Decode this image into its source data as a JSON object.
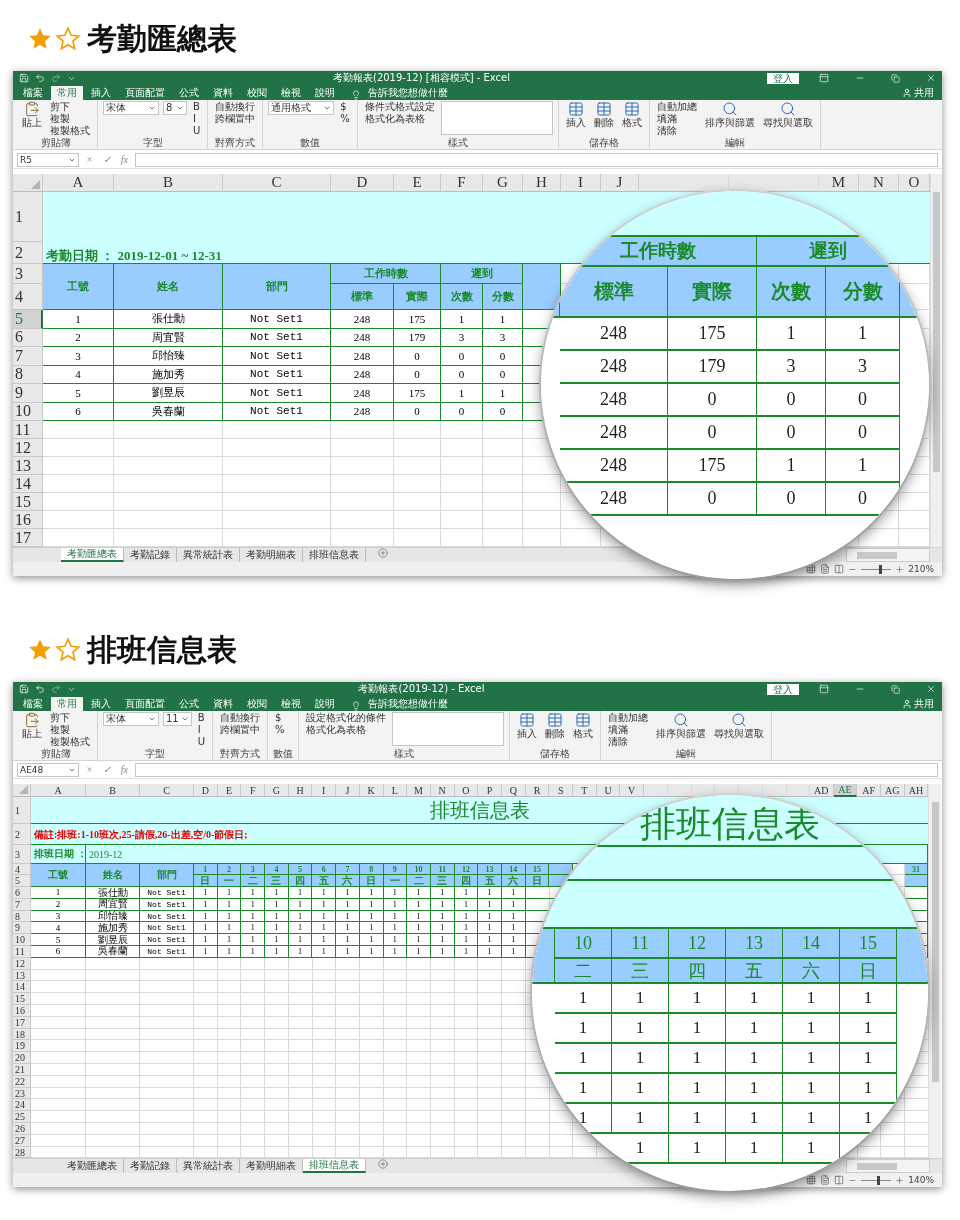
{
  "panels": [
    {
      "heading": "考勤匯總表",
      "window": {
        "title": "考勤報表(2019-12) [相容模式] - Excel",
        "sign_in": "登入",
        "tabs": [
          {
            "label": "檔案",
            "selected": false
          },
          {
            "label": "常用",
            "selected": true
          },
          {
            "label": "插入",
            "selected": false
          },
          {
            "label": "頁面配置",
            "selected": false
          },
          {
            "label": "公式",
            "selected": false
          },
          {
            "label": "資料",
            "selected": false
          },
          {
            "label": "校閱",
            "selected": false
          },
          {
            "label": "檢視",
            "selected": false
          },
          {
            "label": "說明",
            "selected": false
          }
        ],
        "tell_me": "告訴我您想做什麼",
        "share": "共用",
        "ribbon_groups": [
          {
            "label": "剪貼簿",
            "big": [
              "貼上"
            ],
            "items": [
              "剪下",
              "複製",
              "複製格式"
            ]
          },
          {
            "label": "字型",
            "fields": [
              "宋体",
              "8"
            ],
            "items": [
              "B",
              "I",
              "U"
            ]
          },
          {
            "label": "對齊方式",
            "items": [
              "自動換行",
              "跨欄置中"
            ]
          },
          {
            "label": "數值",
            "fields": [
              "通用格式"
            ],
            "items": [
              "$",
              "%"
            ]
          },
          {
            "label": "樣式",
            "items": [
              "條件式格式設定",
              "格式化為表格"
            ],
            "gallery": true
          },
          {
            "label": "儲存格",
            "big": [
              "插入",
              "刪除",
              "格式"
            ]
          },
          {
            "label": "編輯",
            "items": [
              "自動加總",
              "填滿",
              "清除"
            ],
            "big": [
              "排序與篩選",
              "尋找與選取"
            ]
          }
        ],
        "name_box": "R5",
        "formula_buttons": [
          "×",
          "✓",
          "fx"
        ],
        "sheet": {
          "kind": "summary",
          "column_headers": [
            {
              "label": "A",
              "selected": false
            },
            {
              "label": "B",
              "selected": false
            },
            {
              "label": "C",
              "selected": false
            },
            {
              "label": "D",
              "selected": false
            },
            {
              "label": "E",
              "selected": false
            },
            {
              "label": "F",
              "selected": false
            },
            {
              "label": "G",
              "selected": false
            },
            {
              "label": "H",
              "selected": false
            },
            {
              "label": "I",
              "selected": false
            },
            {
              "label": "J",
              "selected": false
            },
            {
              "label": "M",
              "selected": false
            },
            {
              "label": "N",
              "selected": false
            },
            {
              "label": "O",
              "selected": false
            }
          ],
          "row_headers": [
            {
              "label": "1",
              "selected": false
            },
            {
              "label": "2",
              "selected": false
            },
            {
              "label": "3",
              "selected": false
            },
            {
              "label": "4",
              "selected": false
            },
            {
              "label": "5",
              "selected": true
            },
            {
              "label": "6",
              "selected": false
            },
            {
              "label": "7",
              "selected": false
            },
            {
              "label": "8",
              "selected": false
            },
            {
              "label": "9",
              "selected": false
            },
            {
              "label": "10",
              "selected": false
            },
            {
              "label": "11",
              "selected": false
            },
            {
              "label": "12",
              "selected": false
            },
            {
              "label": "13",
              "selected": false
            },
            {
              "label": "14",
              "selected": false
            },
            {
              "label": "15",
              "selected": false
            },
            {
              "label": "16",
              "selected": false
            },
            {
              "label": "17",
              "selected": false
            }
          ],
          "date_line": "考勤日期 ：  2019-12-01 ~ 12-31",
          "headers": [
            "工號",
            "姓名",
            "部門"
          ],
          "groups": [
            "工作時數",
            "遲到"
          ],
          "sub_headers": [
            "標準",
            "實際",
            "次數",
            "分數"
          ],
          "rows": [
            [
              "1",
              "張仕勳",
              "Not Set1",
              "248",
              "175",
              "1",
              "1"
            ],
            [
              "2",
              "周宜賢",
              "Not Set1",
              "248",
              "179",
              "3",
              "3"
            ],
            [
              "3",
              "邱怡臻",
              "Not Set1",
              "248",
              "0",
              "0",
              "0"
            ],
            [
              "4",
              "施加秀",
              "Not Set1",
              "248",
              "0",
              "0",
              "0"
            ],
            [
              "5",
              "劉昱辰",
              "Not Set1",
              "248",
              "175",
              "1",
              "1"
            ],
            [
              "6",
              "吳春蘭",
              "Not Set1",
              "248",
              "0",
              "0",
              "0"
            ]
          ]
        },
        "sheet_tabs": [
          {
            "label": "考勤匯總表",
            "selected": true
          },
          {
            "label": "考勤記錄",
            "selected": false
          },
          {
            "label": "異常統計表",
            "selected": false
          },
          {
            "label": "考勤明細表",
            "selected": false
          },
          {
            "label": "排班信息表",
            "selected": false
          }
        ],
        "zoom": {
          "label": "210%",
          "level": 0.62
        }
      },
      "magnifier": {
        "kind": "summary",
        "groups": [
          "工作時數",
          "遲到"
        ],
        "sub_headers": [
          "標準",
          "實際",
          "次數",
          "分數"
        ],
        "rows": [
          [
            "248",
            "175",
            "1",
            "1"
          ],
          [
            "248",
            "179",
            "3",
            "3"
          ],
          [
            "248",
            "0",
            "0",
            "0"
          ],
          [
            "248",
            "0",
            "0",
            "0"
          ],
          [
            "248",
            "175",
            "1",
            "1"
          ],
          [
            "248",
            "0",
            "0",
            "0"
          ]
        ]
      }
    },
    {
      "heading": "排班信息表",
      "window": {
        "title": "考勤報表(2019-12) - Excel",
        "sign_in": "登入",
        "tabs": [
          {
            "label": "檔案",
            "selected": false
          },
          {
            "label": "常用",
            "selected": true
          },
          {
            "label": "插入",
            "selected": false
          },
          {
            "label": "頁面配置",
            "selected": false
          },
          {
            "label": "公式",
            "selected": false
          },
          {
            "label": "資料",
            "selected": false
          },
          {
            "label": "校閱",
            "selected": false
          },
          {
            "label": "檢視",
            "selected": false
          },
          {
            "label": "說明",
            "selected": false
          }
        ],
        "tell_me": "告訴我您想做什麼",
        "share": "共用",
        "ribbon_groups": [
          {
            "label": "剪貼簿",
            "big": [
              "貼上"
            ],
            "items": [
              "剪下",
              "複製",
              "複製格式"
            ]
          },
          {
            "label": "字型",
            "fields": [
              "宋体",
              "11"
            ],
            "items": [
              "B",
              "I",
              "U"
            ]
          },
          {
            "label": "對齊方式",
            "items": [
              "自動換行",
              "跨欄置中"
            ]
          },
          {
            "label": "數值",
            "items": [
              "$",
              "%"
            ]
          },
          {
            "label": "樣式",
            "items": [
              "設定格式化的條件",
              "格式化為表格"
            ],
            "gallery": true
          },
          {
            "label": "儲存格",
            "big": [
              "插入",
              "刪除",
              "格式"
            ]
          },
          {
            "label": "編輯",
            "items": [
              "自動加總",
              "填滿",
              "清除"
            ],
            "big": [
              "排序與篩選",
              "尋找與選取"
            ]
          }
        ],
        "name_box": "AE48",
        "formula_buttons": [
          "×",
          "✓",
          "fx"
        ],
        "sheet": {
          "kind": "schedule",
          "column_headers": [
            {
              "label": "A",
              "selected": false
            },
            {
              "label": "B",
              "selected": false
            },
            {
              "label": "C",
              "selected": false
            },
            {
              "label": "D",
              "selected": false
            },
            {
              "label": "E",
              "selected": false
            },
            {
              "label": "F",
              "selected": false
            },
            {
              "label": "G",
              "selected": false
            },
            {
              "label": "H",
              "selected": false
            },
            {
              "label": "I",
              "selected": false
            },
            {
              "label": "J",
              "selected": false
            },
            {
              "label": "K",
              "selected": false
            },
            {
              "label": "L",
              "selected": false
            },
            {
              "label": "M",
              "selected": false
            },
            {
              "label": "N",
              "selected": false
            },
            {
              "label": "O",
              "selected": false
            },
            {
              "label": "P",
              "selected": false
            },
            {
              "label": "Q",
              "selected": false
            },
            {
              "label": "R",
              "selected": false
            },
            {
              "label": "S",
              "selected": false
            },
            {
              "label": "T",
              "selected": false
            },
            {
              "label": "U",
              "selected": false
            },
            {
              "label": "V",
              "selected": false
            },
            {
              "label": "AD",
              "selected": false
            },
            {
              "label": "AE",
              "selected": true
            },
            {
              "label": "AF",
              "selected": false
            },
            {
              "label": "AG",
              "selected": false
            },
            {
              "label": "AH",
              "selected": false
            }
          ],
          "row_headers": [
            {
              "label": "1",
              "selected": false
            },
            {
              "label": "2",
              "selected": false
            },
            {
              "label": "3",
              "selected": false
            },
            {
              "label": "4",
              "selected": false
            },
            {
              "label": "5",
              "selected": false
            },
            {
              "label": "6",
              "selected": false
            },
            {
              "label": "7",
              "selected": false
            },
            {
              "label": "8",
              "selected": false
            },
            {
              "label": "9",
              "selected": false
            },
            {
              "label": "10",
              "selected": false
            },
            {
              "label": "11",
              "selected": false
            },
            {
              "label": "12",
              "selected": false
            },
            {
              "label": "13",
              "selected": false
            },
            {
              "label": "14",
              "selected": false
            },
            {
              "label": "15",
              "selected": false
            },
            {
              "label": "16",
              "selected": false
            },
            {
              "label": "17",
              "selected": false
            },
            {
              "label": "18",
              "selected": false
            },
            {
              "label": "19",
              "selected": false
            },
            {
              "label": "20",
              "selected": false
            },
            {
              "label": "21",
              "selected": false
            },
            {
              "label": "22",
              "selected": false
            },
            {
              "label": "23",
              "selected": false
            },
            {
              "label": "24",
              "selected": false
            },
            {
              "label": "25",
              "selected": false
            },
            {
              "label": "26",
              "selected": false
            },
            {
              "label": "27",
              "selected": false
            },
            {
              "label": "28",
              "selected": false
            }
          ],
          "title": "排班信息表",
          "note": "備註:排班:1-10班次,25-請假,26-出差,空/0-節假日;",
          "date_label": "排班日期 ：",
          "date_value": "2019-12",
          "headers": [
            "工號",
            "姓名",
            "部門"
          ],
          "day_numbers": [
            "1",
            "2",
            "3",
            "4",
            "5",
            "6",
            "7",
            "8",
            "9",
            "10",
            "11",
            "12",
            "13",
            "14",
            "15"
          ],
          "weekdays": [
            "日",
            "一",
            "二",
            "三",
            "四",
            "五",
            "六",
            "日",
            "一",
            "二",
            "三",
            "四",
            "五",
            "六",
            "日"
          ],
          "last_day": "31",
          "rows": [
            {
              "id": "1",
              "name": "張仕勳",
              "dept": "Not Set1",
              "days": [
                "1",
                "1",
                "1",
                "1",
                "1",
                "1",
                "1",
                "1",
                "1",
                "1",
                "1",
                "1",
                "1",
                "1"
              ]
            },
            {
              "id": "2",
              "name": "周宜賢",
              "dept": "Not Set1",
              "days": [
                "1",
                "1",
                "1",
                "1",
                "1",
                "1",
                "1",
                "1",
                "1",
                "1",
                "1",
                "1",
                "1",
                "1"
              ]
            },
            {
              "id": "3",
              "name": "邱怡臻",
              "dept": "Not Set1",
              "days": [
                "1",
                "1",
                "1",
                "1",
                "1",
                "1",
                "1",
                "1",
                "1",
                "1",
                "1",
                "1",
                "1",
                "1"
              ]
            },
            {
              "id": "4",
              "name": "施加秀",
              "dept": "Not Set1",
              "days": [
                "1",
                "1",
                "1",
                "1",
                "1",
                "1",
                "1",
                "1",
                "1",
                "1",
                "1",
                "1",
                "1",
                "1"
              ]
            },
            {
              "id": "5",
              "name": "劉昱辰",
              "dept": "Not Set1",
              "days": [
                "1",
                "1",
                "1",
                "1",
                "1",
                "1",
                "1",
                "1",
                "1",
                "1",
                "1",
                "1",
                "1",
                "1"
              ]
            },
            {
              "id": "6",
              "name": "吳春蘭",
              "dept": "Not Set1",
              "days": [
                "1",
                "1",
                "1",
                "1",
                "1",
                "1",
                "1",
                "1",
                "1",
                "1",
                "1",
                "1",
                "1",
                "1"
              ]
            }
          ]
        },
        "sheet_tabs": [
          {
            "label": "考勤匯總表",
            "selected": false
          },
          {
            "label": "考勤記錄",
            "selected": false
          },
          {
            "label": "異常統計表",
            "selected": false
          },
          {
            "label": "考勤明細表",
            "selected": false
          },
          {
            "label": "排班信息表",
            "selected": true
          }
        ],
        "zoom": {
          "label": "140%",
          "level": 0.55
        }
      },
      "magnifier": {
        "kind": "schedule",
        "title": "排班信息表",
        "day_numbers": [
          "10",
          "11",
          "12",
          "13",
          "14",
          "15"
        ],
        "weekdays": [
          "二",
          "三",
          "四",
          "五",
          "六",
          "日"
        ],
        "rows": [
          [
            "1",
            "1",
            "1",
            "1",
            "1",
            "1"
          ],
          [
            "1",
            "1",
            "1",
            "1",
            "1",
            "1"
          ],
          [
            "1",
            "1",
            "1",
            "1",
            "1",
            "1"
          ],
          [
            "1",
            "1",
            "1",
            "1",
            "1",
            "1"
          ],
          [
            "1",
            "1",
            "1",
            "1",
            "1",
            "1"
          ],
          [
            null,
            "1",
            "1",
            "1",
            "1",
            null
          ]
        ]
      }
    }
  ]
}
